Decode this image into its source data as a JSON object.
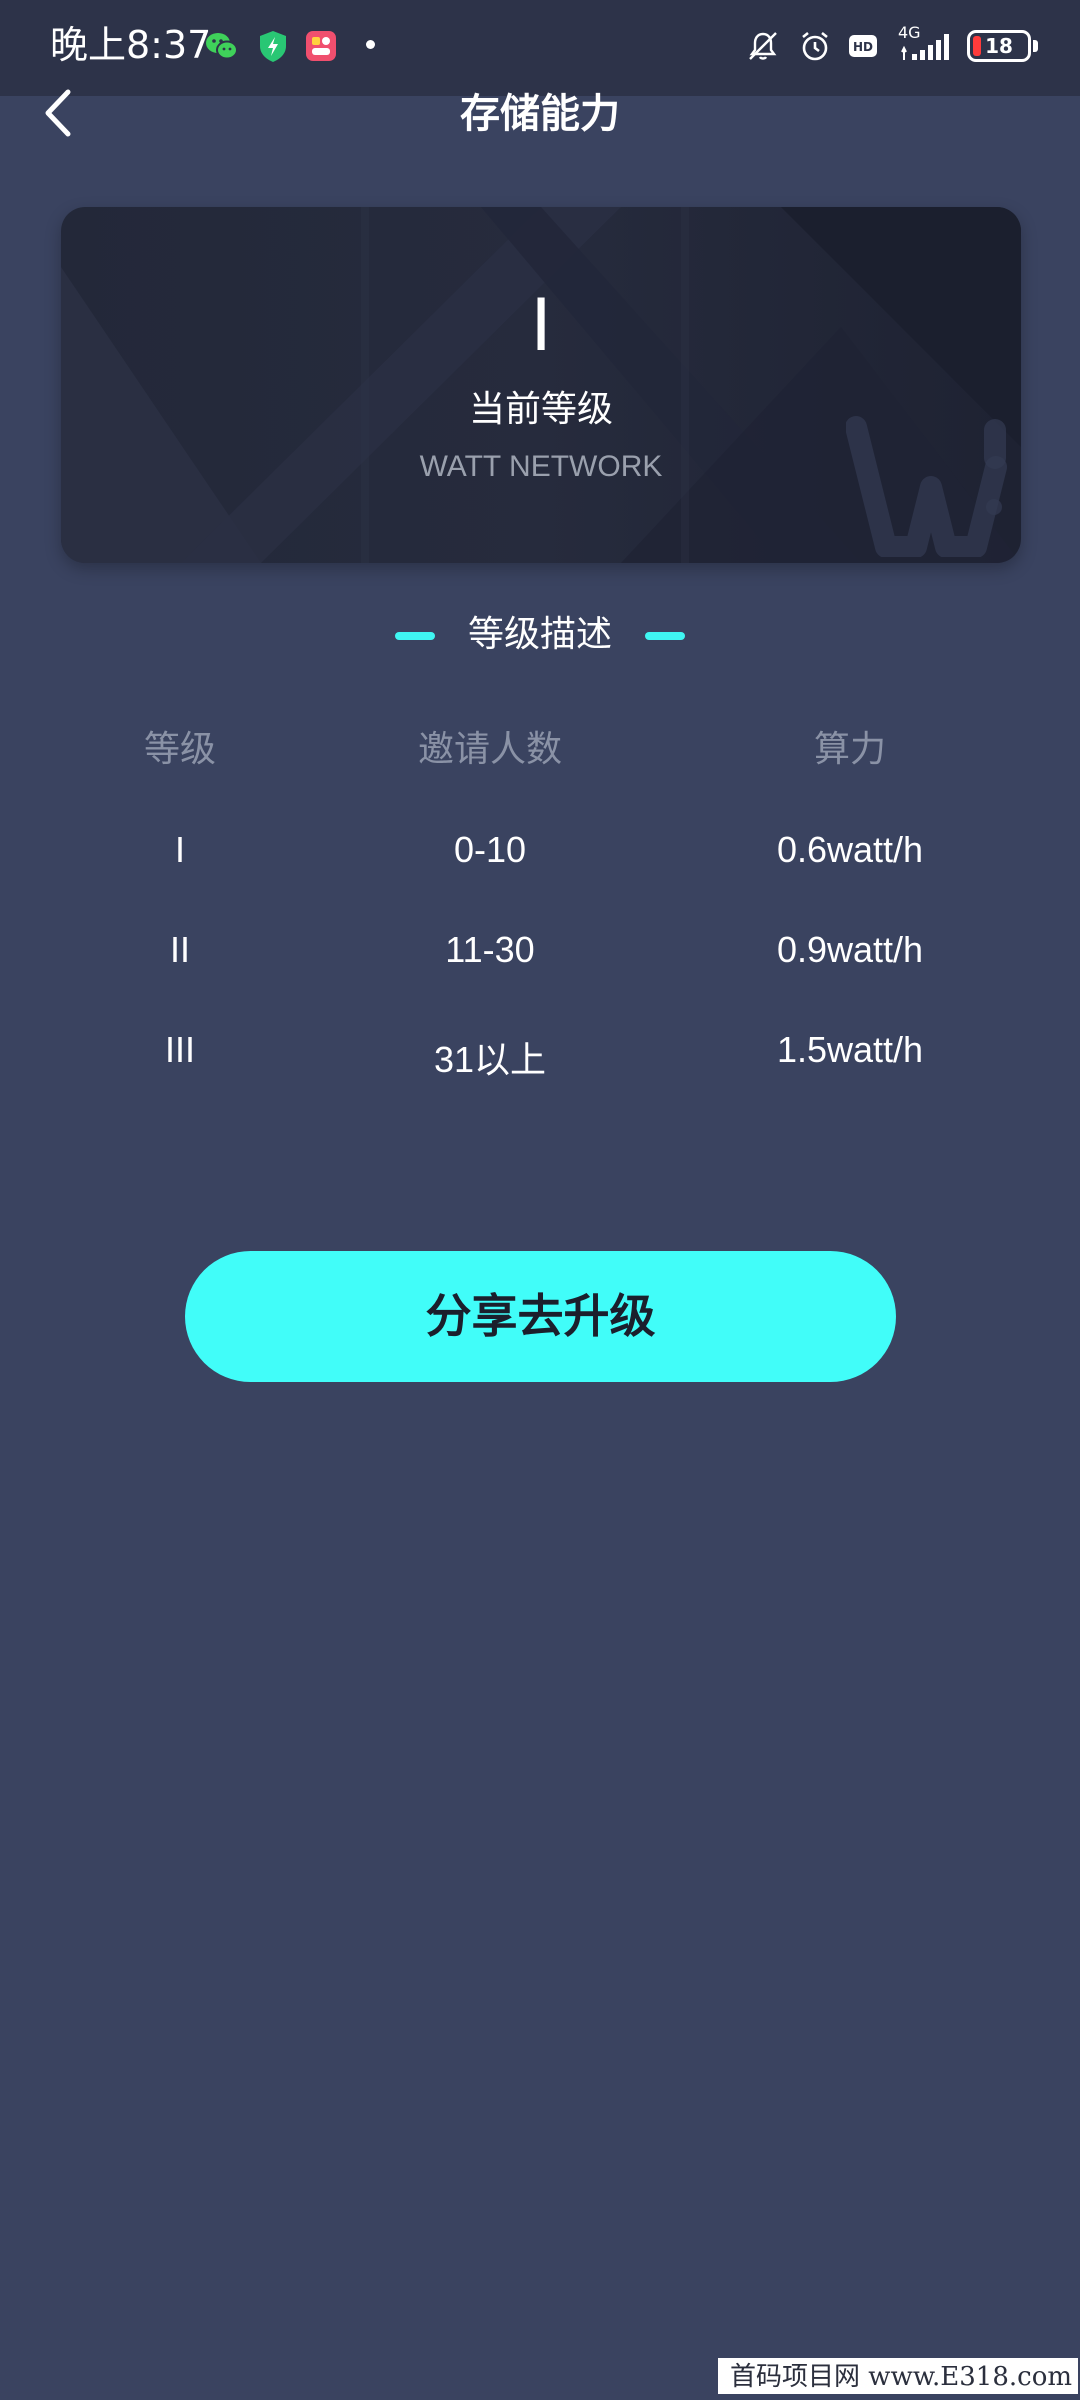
{
  "status_bar": {
    "time": "晚上8:37",
    "network": "4G",
    "battery": "18",
    "icons": [
      "wechat-icon",
      "shield-icon",
      "app-icon",
      "mute-icon",
      "alarm-icon",
      "hd-icon",
      "signal-icon",
      "battery-icon"
    ]
  },
  "header": {
    "title": "存储能力",
    "back_icon": "chevron-left-icon"
  },
  "level_card": {
    "level": "I",
    "label": "当前等级",
    "subtitle": "WATT NETWORK"
  },
  "section": {
    "title": "等级描述"
  },
  "table": {
    "headers": [
      "等级",
      "邀请人数",
      "算力"
    ],
    "rows": [
      [
        "I",
        "0-10",
        "0.6watt/h"
      ],
      [
        "II",
        "11-30",
        "0.9watt/h"
      ],
      [
        "III",
        "31以上",
        "1.5watt/h"
      ]
    ]
  },
  "cta": {
    "label": "分享去升级"
  },
  "watermark": "首码项目网 www.E318.com",
  "colors": {
    "background": "#3a4360",
    "accent": "#41fdf9",
    "card": "#232839",
    "muted_text": "#8a92a6"
  }
}
